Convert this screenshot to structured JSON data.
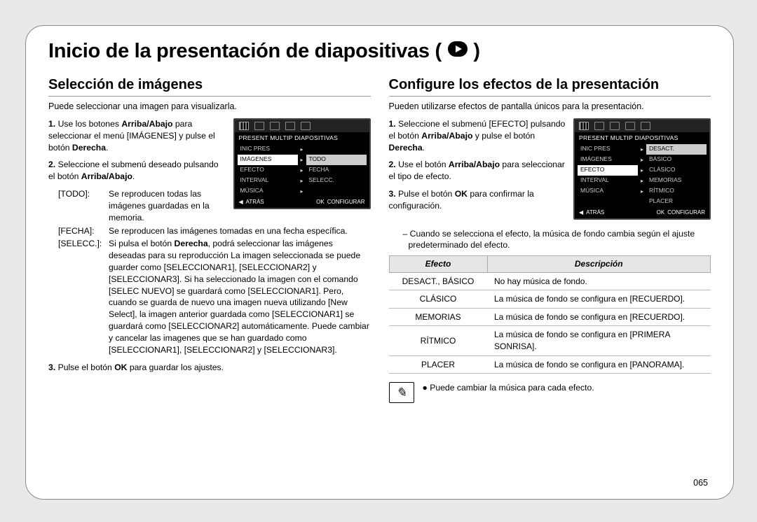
{
  "page_number": "065",
  "page_title": "Inicio de la presentación de diapositivas (",
  "left": {
    "heading": "Selección de imágenes",
    "intro": "Puede seleccionar una imagen para visualizarla.",
    "step1_a": "Use los botones ",
    "step1_b": "Arriba/Abajo",
    "step1_c": " para seleccionar el menú [IMÁGENES] y pulse el botón ",
    "step1_d": "Derecha",
    "step1_e": ".",
    "step2_a": "Seleccione el submenú deseado pulsando el botón ",
    "step2_b": "Arriba/Abajo",
    "step2_c": ".",
    "def_todo_k": "[TODO]:",
    "def_todo_v": "Se reproducen todas las imágenes guardadas en la memoria.",
    "def_fecha_k": "[FECHA]:",
    "def_fecha_v": "Se reproducen las imágenes tomadas en una fecha específica.",
    "def_selec_k": "[SELECC.]:",
    "def_selec_v_a": "Si pulsa el botón ",
    "def_selec_v_b": "Derecha",
    "def_selec_v_c": ", podrá seleccionar las imágenes deseadas para su reproducción La imagen seleccionada se puede guarder como [SELECCIONAR1], [SELECCIONAR2] y [SELECCIONAR3]. Si ha seleccionado la imagen con el comando [SELEC NUEVO] se guardará como [SELECCIONAR1]. Pero, cuando se guarda de nuevo una imagen nueva utilizando [New Select], la imagen anterior guardada como [SELECCIONAR1] se guardará como [SELECCIONAR2] automáticamente. Puede cambiar y cancelar las imagenes que se han guardado como [SELECCIONAR1], [SELECCIONAR2] y [SELECCIONAR3].",
    "step3_a": "Pulse el botón ",
    "step3_b": "OK",
    "step3_c": " para guardar los ajustes.",
    "menu": {
      "title": "PRESENT MULTIP DIAPOSITIVAS",
      "rows": [
        [
          "INIC PRES",
          ""
        ],
        [
          "IMÁGENES",
          "TODO"
        ],
        [
          "EFECTO",
          "FECHA"
        ],
        [
          "INTERVAL",
          "SELECC."
        ],
        [
          "MÚSICA",
          ""
        ]
      ],
      "footer_left": "ATRÁS",
      "footer_ok": "OK",
      "footer_right": "CONFIGURAR"
    }
  },
  "right": {
    "heading": "Configure los efectos de la presentación",
    "intro": "Pueden utilizarse efectos de pantalla únicos para la presentación.",
    "step1_a": "Seleccione el submenú [EFECTO] pulsando el botón ",
    "step1_b": "Arriba/Abajo",
    "step1_c": " y pulse el botón ",
    "step1_d": "Derecha",
    "step1_e": ".",
    "step2_a": "Use el botón ",
    "step2_b": "Arriba/Abajo",
    "step2_c": " para seleccionar el tipo de efecto.",
    "step3_a": "Pulse el botón ",
    "step3_b": "OK",
    "step3_c": " para confirmar la configuración.",
    "dash": "Cuando se selecciona el efecto, la música de fondo cambia según el ajuste predeterminado del efecto.",
    "table": {
      "h1": "Efecto",
      "h2": "Descripción",
      "rows": [
        [
          "DESACT., BÁSICO",
          "No hay música de fondo."
        ],
        [
          "CLÁSICO",
          "La música de fondo se configura en [RECUERDO]."
        ],
        [
          "MEMORIAS",
          "La música de fondo se configura en [RECUERDO]."
        ],
        [
          "RÍTMICO",
          "La música de fondo se configura en [PRIMERA SONRISA]."
        ],
        [
          "PLACER",
          "La música de fondo se configura en [PANORAMA]."
        ]
      ]
    },
    "note": "Puede cambiar la música para cada efecto.",
    "menu": {
      "title": "PRESENT MULTIP DIAPOSITIVAS",
      "rows": [
        [
          "INIC PRES",
          "DESACT."
        ],
        [
          "IMÁGENES",
          "BÁSICO"
        ],
        [
          "EFECTO",
          "CLÁSICO"
        ],
        [
          "INTERVAL",
          "MEMORIAS"
        ],
        [
          "MÚSICA",
          "RÍTMICO"
        ],
        [
          "",
          "PLACER"
        ]
      ],
      "footer_left": "ATRÁS",
      "footer_ok": "OK",
      "footer_right": "CONFIGURAR"
    }
  }
}
